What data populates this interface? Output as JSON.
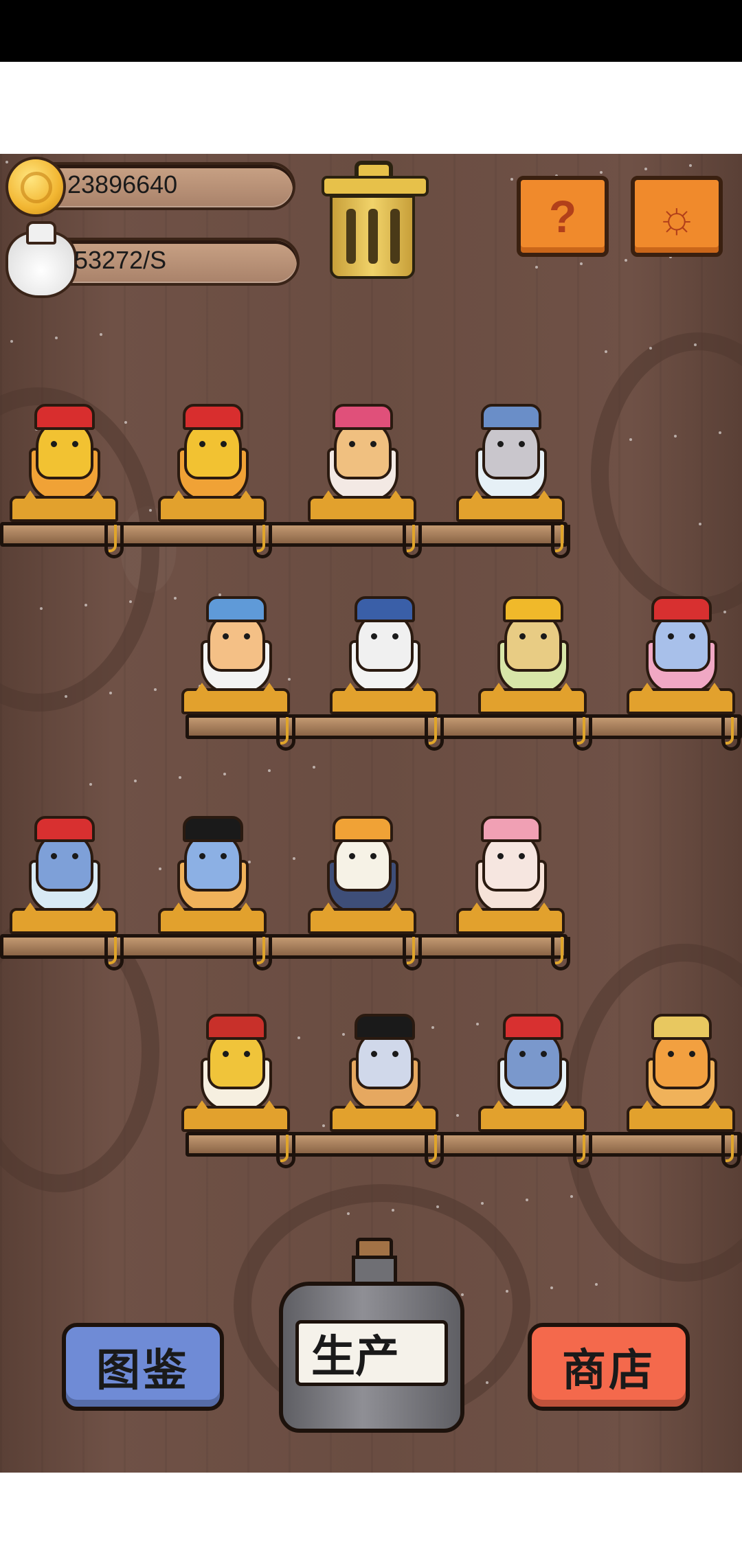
{
  "hud": {
    "coins": "23896640",
    "income_rate": "53272/S",
    "help_glyph": "?",
    "settings_glyph": "☼"
  },
  "shelves": [
    {
      "row": 1,
      "cats": [
        {
          "name": "cat-red-crown",
          "color": "#f2c232",
          "cup": "#f0a236",
          "accent": "#d82e2e"
        },
        {
          "name": "cat-red-crown",
          "color": "#f2c232",
          "cup": "#f0a236",
          "accent": "#d82e2e"
        },
        {
          "name": "cat-tabby-pink",
          "color": "#f0c080",
          "cup": "#f3e9e4",
          "accent": "#e0507a"
        },
        {
          "name": "cat-grey-flatcap",
          "color": "#c9c6cc",
          "cup": "#e6f0f6",
          "accent": "#6a8ec8"
        }
      ]
    },
    {
      "row": 2,
      "cats": [
        {
          "name": "cat-pharaoh-blue",
          "color": "#f4c086",
          "cup": "#f3f3f3",
          "accent": "#5f9ad8"
        },
        {
          "name": "cat-qing-official",
          "color": "#f0f0f0",
          "cup": "#f3f3f3",
          "accent": "#3a5fa8"
        },
        {
          "name": "cat-sunflower",
          "color": "#e8cc84",
          "cup": "#d8e6a8",
          "accent": "#f0b92a"
        },
        {
          "name": "cat-blue-royal",
          "color": "#a8c0ea",
          "cup": "#f0a8c4",
          "accent": "#d83030"
        }
      ]
    },
    {
      "row": 3,
      "cats": [
        {
          "name": "cat-soviet-hat",
          "color": "#7ea0d8",
          "cup": "#d8eaf4",
          "accent": "#d83030"
        },
        {
          "name": "cat-pirate",
          "color": "#8cb0e4",
          "cup": "#f0b25a",
          "accent": "#1a1a1a"
        },
        {
          "name": "cat-calico",
          "color": "#f6f2e6",
          "cup": "#3e4e78",
          "accent": "#f0a236"
        },
        {
          "name": "cat-pink-blossom",
          "color": "#f6e6e0",
          "cup": "#f6e2d8",
          "accent": "#f0a0b4"
        }
      ]
    },
    {
      "row": 4,
      "cats": [
        {
          "name": "cat-emperor-gold",
          "color": "#f0c43a",
          "cup": "#f6efe0",
          "accent": "#c8302a"
        },
        {
          "name": "cat-sunglasses",
          "color": "#d0d8ea",
          "cup": "#e6a860",
          "accent": "#1a1a1a"
        },
        {
          "name": "cat-tophat-blue",
          "color": "#7a98cc",
          "cup": "#e6f0f6",
          "accent": "#d83030"
        },
        {
          "name": "cat-sombrero",
          "color": "#f2a040",
          "cup": "#f0b25a",
          "accent": "#e8c860"
        }
      ]
    }
  ],
  "bottom": {
    "catalog_label": "图鉴",
    "produce_label": "生产",
    "shop_label": "商店",
    "catalog_color": "#6f8bd6",
    "shop_color": "#f4694c"
  }
}
